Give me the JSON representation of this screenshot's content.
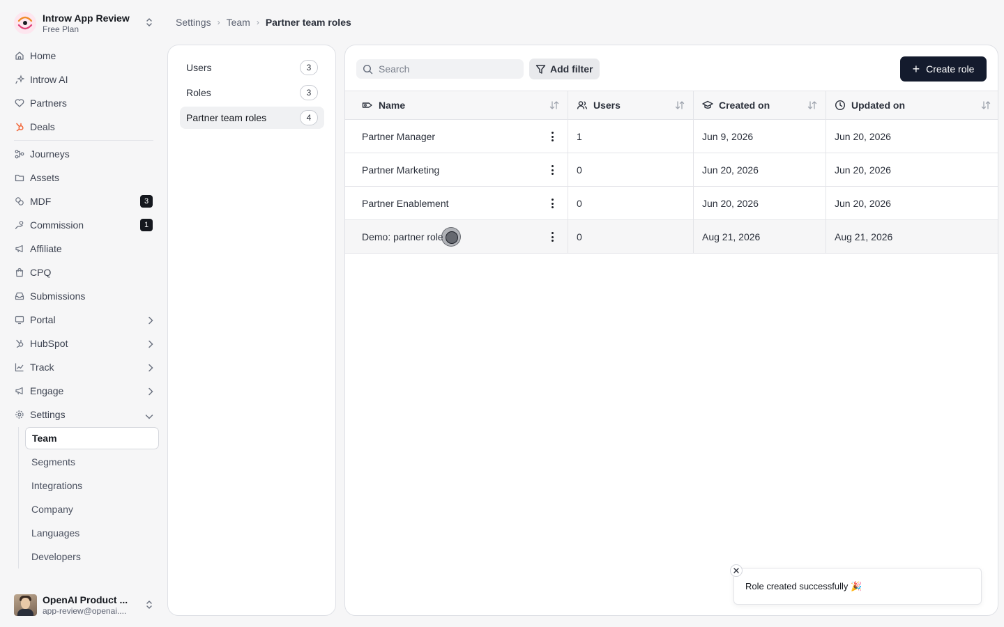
{
  "workspace": {
    "name": "Introw App Review",
    "plan": "Free Plan"
  },
  "nav": {
    "home": "Home",
    "introw_ai": "Introw AI",
    "partners": "Partners",
    "deals": "Deals",
    "journeys": "Journeys",
    "assets": "Assets",
    "mdf": "MDF",
    "mdf_badge": "3",
    "commission": "Commission",
    "commission_badge": "1",
    "affiliate": "Affiliate",
    "cpq": "CPQ",
    "submissions": "Submissions",
    "portal": "Portal",
    "hubspot": "HubSpot",
    "track": "Track",
    "engage": "Engage",
    "settings": "Settings",
    "settings_sub": [
      "Team",
      "Segments",
      "Integrations",
      "Company",
      "Languages",
      "Developers"
    ]
  },
  "user": {
    "name": "OpenAI Product ...",
    "email": "app-review@openai...."
  },
  "breadcrumb": [
    "Settings",
    "Team",
    "Partner team roles"
  ],
  "subpanel": [
    {
      "label": "Users",
      "count": "3"
    },
    {
      "label": "Roles",
      "count": "3"
    },
    {
      "label": "Partner team roles",
      "count": "4"
    }
  ],
  "toolbar": {
    "search_placeholder": "Search",
    "add_filter": "Add filter",
    "create_role": "Create role"
  },
  "table": {
    "columns": [
      "Name",
      "Users",
      "Created on",
      "Updated on"
    ],
    "rows": [
      {
        "name": "Partner Manager",
        "users": "1",
        "created": "Jun 9, 2026",
        "updated": "Jun 20, 2026"
      },
      {
        "name": "Partner Marketing",
        "users": "0",
        "created": "Jun 20, 2026",
        "updated": "Jun 20, 2026"
      },
      {
        "name": "Partner Enablement",
        "users": "0",
        "created": "Jun 20, 2026",
        "updated": "Jun 20, 2026"
      },
      {
        "name": "Demo: partner role",
        "users": "0",
        "created": "Aug 21, 2026",
        "updated": "Aug 21, 2026"
      }
    ]
  },
  "toast": {
    "message": "Role created successfully",
    "emoji": "🎉"
  },
  "colors": {
    "primary_button": "#141b2d",
    "active_bg": "#f0f1f3",
    "deals_icon": "#f26a3d"
  }
}
